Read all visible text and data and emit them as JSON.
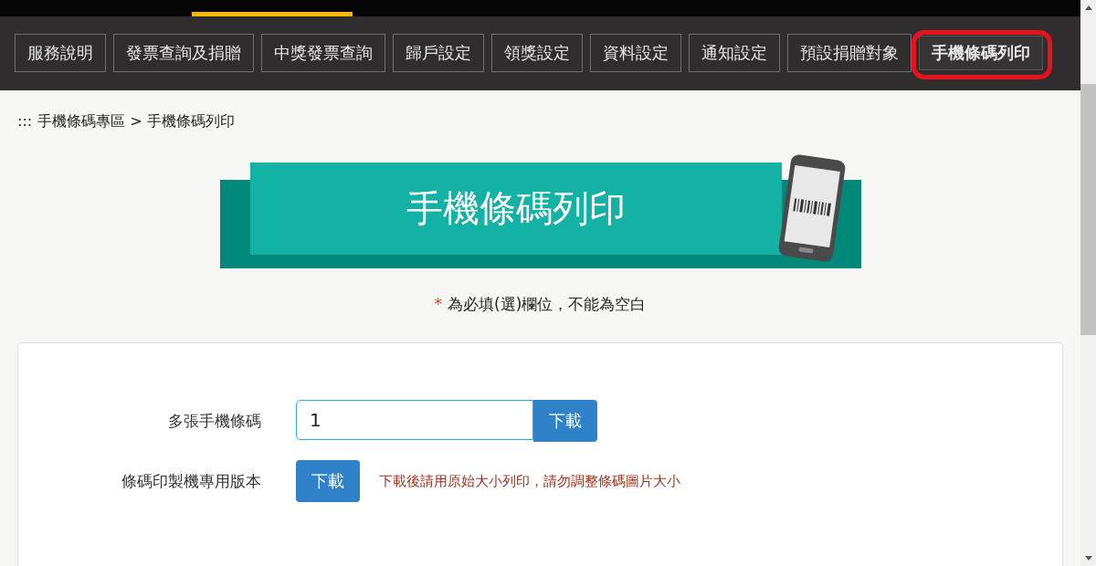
{
  "tabs": [
    {
      "label": "服務說明",
      "selected": false
    },
    {
      "label": "發票查詢及捐贈",
      "selected": false
    },
    {
      "label": "中獎發票查詢",
      "selected": false
    },
    {
      "label": "歸戶設定",
      "selected": false
    },
    {
      "label": "領獎設定",
      "selected": false
    },
    {
      "label": "資料設定",
      "selected": false
    },
    {
      "label": "通知設定",
      "selected": false
    },
    {
      "label": "預設捐贈對象",
      "selected": false
    },
    {
      "label": "手機條碼列印",
      "selected": true
    }
  ],
  "breadcrumb": {
    "prefix": ":::",
    "path": "手機條碼專區 > 手機條碼列印"
  },
  "banner": {
    "title": "手機條碼列印"
  },
  "required_note": {
    "mark": "*",
    "text": "為必填(選)欄位，不能為空白"
  },
  "form": {
    "rows": [
      {
        "kind": "input",
        "label": "多張手機條碼",
        "value": "1",
        "button": "下載"
      },
      {
        "kind": "button",
        "label": "條碼印製機專用版本",
        "button": "下載",
        "note": "下載後請用原始大小列印，請勿調整條碼圖片大小"
      }
    ]
  }
}
